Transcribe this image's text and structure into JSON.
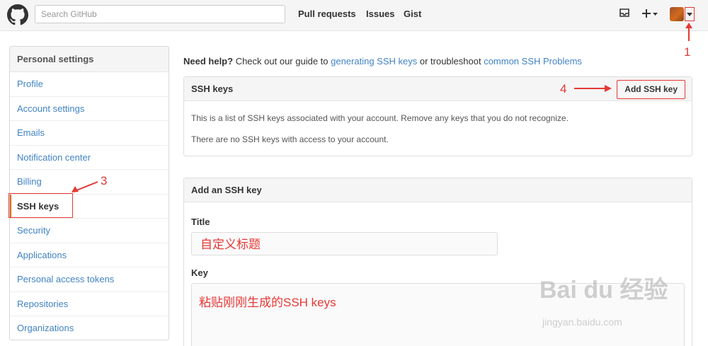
{
  "header": {
    "search_placeholder": "Search GitHub",
    "nav": [
      "Pull requests",
      "Issues",
      "Gist"
    ]
  },
  "sidebar": {
    "title": "Personal settings",
    "items": [
      {
        "label": "Profile"
      },
      {
        "label": "Account settings"
      },
      {
        "label": "Emails"
      },
      {
        "label": "Notification center"
      },
      {
        "label": "Billing"
      },
      {
        "label": "SSH keys",
        "selected": true
      },
      {
        "label": "Security"
      },
      {
        "label": "Applications"
      },
      {
        "label": "Personal access tokens"
      },
      {
        "label": "Repositories"
      },
      {
        "label": "Organizations"
      }
    ]
  },
  "help": {
    "bold": "Need help?",
    "text1": " Check out our guide to ",
    "link1": "generating SSH keys",
    "text2": " or troubleshoot ",
    "link2": "common SSH Problems"
  },
  "ssh_box": {
    "title": "SSH keys",
    "add_button": "Add SSH key",
    "line1": "This is a list of SSH keys associated with your account. Remove any keys that you do not recognize.",
    "line2": "There are no SSH keys with access to your account."
  },
  "add_box": {
    "title": "Add an SSH key",
    "title_label": "Title",
    "title_value": "自定义标题",
    "key_label": "Key",
    "key_value": "粘贴刚刚生成的SSH keys"
  },
  "annotations": {
    "n1": "1",
    "n3": "3",
    "n4": "4"
  },
  "watermark": {
    "text": "Bai du 经验",
    "sub": "jingyan.baidu.com"
  },
  "colors": {
    "annotation": "#e53935",
    "link": "#4183c4"
  }
}
